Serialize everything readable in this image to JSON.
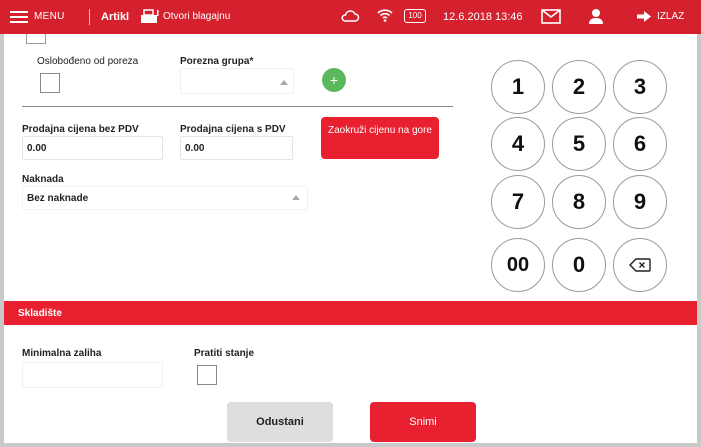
{
  "topbar": {
    "menu_label": "MENU",
    "artikl_label": "Artikl",
    "open_register_label": "Otvori blagajnu",
    "battery_label": "100",
    "datetime": "12.6.2018 13:46",
    "exit_label": "IZLAZ",
    "icons": [
      "hamburger-icon",
      "cash-register-icon",
      "cloud-icon",
      "wifi-icon",
      "battery-icon",
      "mail-icon",
      "user-icon",
      "exit-arrow-icon"
    ],
    "bar_color": "#d5202e"
  },
  "form": {
    "tax_exempt_label": "Oslobođeno od poreza",
    "tax_group_label": "Porezna grupa*",
    "tax_group_value": "",
    "price_no_vat_label": "Prodajna cijena bez PDV",
    "price_no_vat_value": "0.00",
    "price_vat_label": "Prodajna cijena s PDV",
    "price_vat_value": "0.00",
    "round_button_label": "Zaokruži cijenu na gore",
    "fee_label": "Naknada",
    "fee_value": "Bez naknade"
  },
  "keypad": {
    "keys": [
      "1",
      "2",
      "3",
      "4",
      "5",
      "6",
      "7",
      "8",
      "9",
      "00",
      "0"
    ],
    "backspace_icon": "backspace-icon"
  },
  "warehouse": {
    "section_title": "Skladište",
    "min_stock_label": "Minimalna zaliha",
    "min_stock_value": "",
    "track_stock_label": "Pratiti stanje"
  },
  "actions": {
    "cancel_label": "Odustani",
    "save_label": "Snimi"
  },
  "colors": {
    "accent": "#e8202f",
    "add_button": "#5cb85c",
    "cancel_button": "#dedede"
  }
}
